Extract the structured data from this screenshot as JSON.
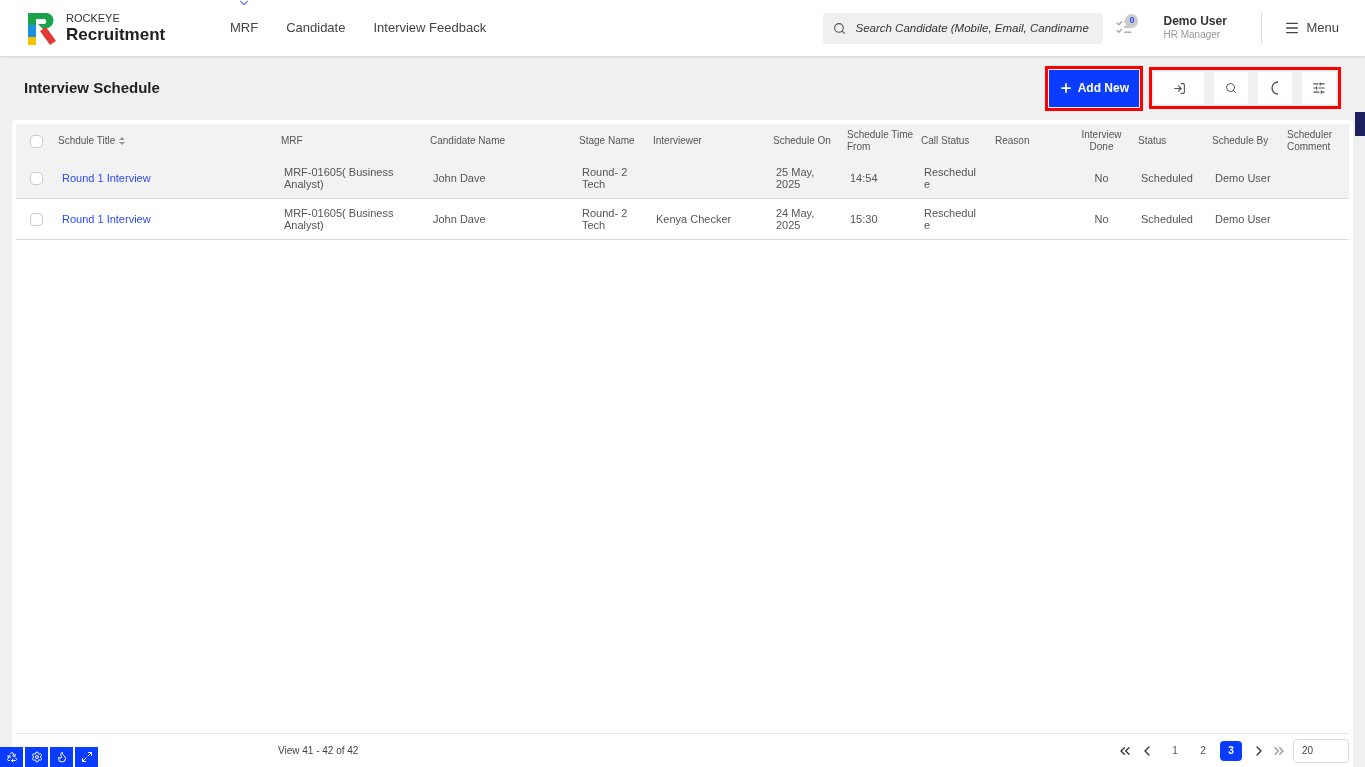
{
  "brand": {
    "top": "ROCKEYE",
    "name": "Recruitment"
  },
  "nav": [
    {
      "label": "MRF",
      "dropdown": true
    },
    {
      "label": "Candidate",
      "dropdown": false
    },
    {
      "label": "Interview Feedback",
      "dropdown": false
    }
  ],
  "search": {
    "placeholder": "Search Candidate (Mobile, Email, Candiname"
  },
  "notifications": {
    "count": "0"
  },
  "user": {
    "name": "Demo User",
    "role": "HR Manager"
  },
  "menu": {
    "label": "Menu"
  },
  "page": {
    "title": "Interview Schedule",
    "add_button": "Add New"
  },
  "table": {
    "select_all": false,
    "columns": [
      {
        "label": "Schdule Title",
        "sorted": true
      },
      {
        "label": "MRF",
        "sorted": false
      },
      {
        "label": "Candidate Name",
        "sorted": false
      },
      {
        "label": "Stage Name",
        "sorted": false
      },
      {
        "label": "Interviewer",
        "sorted": false
      },
      {
        "label": "Schedule On",
        "sorted": false
      },
      {
        "label": "Schedule Time From",
        "sorted": false
      },
      {
        "label": "Call Status",
        "sorted": false
      },
      {
        "label": "Reason",
        "sorted": false
      },
      {
        "label": "Interview Done",
        "sorted": false
      },
      {
        "label": "Status",
        "sorted": false
      },
      {
        "label": "Schedule By",
        "sorted": false
      },
      {
        "label": "Scheduler Comment",
        "sorted": false
      }
    ],
    "rows": [
      {
        "checked": false,
        "highlighted": true,
        "cells": [
          "Round 1 Interview",
          "MRF-01605( Business Analyst)",
          "John Dave",
          "Round- 2 Tech",
          "",
          "25 May, 2025",
          "14:54",
          "Reschedule",
          "",
          "No",
          "Scheduled",
          "Demo User",
          ""
        ]
      },
      {
        "checked": false,
        "highlighted": false,
        "cells": [
          "Round 1 Interview",
          "MRF-01605( Business Analyst)",
          "John Dave",
          "Round- 2 Tech",
          "Kenya Checker",
          "24 May, 2025",
          "15:30",
          "Reschedule",
          "",
          "No",
          "Scheduled",
          "Demo User",
          ""
        ]
      }
    ]
  },
  "footer": {
    "summary": "View 41 - 42 of 42",
    "pages": [
      {
        "label": "1",
        "selected": false
      },
      {
        "label": "2",
        "selected": false
      },
      {
        "label": "3",
        "selected": true
      }
    ],
    "page_size": "20"
  }
}
